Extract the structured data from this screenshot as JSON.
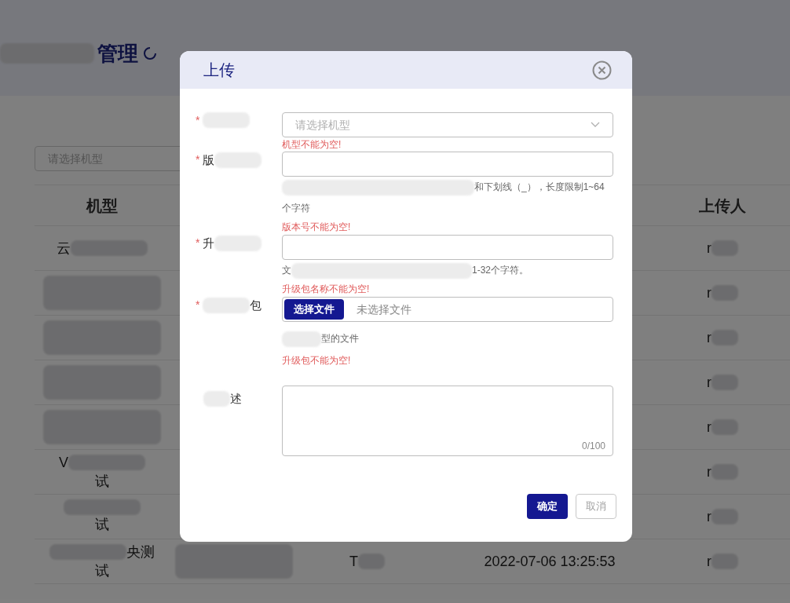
{
  "page": {
    "title_parts": [
      {
        "kind": "blur"
      },
      {
        "kind": "text",
        "text": "管理"
      }
    ],
    "filter": {
      "placeholder": "请选择机型"
    }
  },
  "table": {
    "columns": [
      "机型",
      "",
      "",
      "",
      "上传人"
    ],
    "rows": [
      {
        "cells": [
          {
            "parts": [
              {
                "kind": "text",
                "text": "云"
              },
              {
                "kind": "blur"
              }
            ]
          },
          "",
          "",
          "",
          {
            "parts": [
              {
                "kind": "text",
                "text": "r"
              },
              {
                "kind": "blur"
              }
            ]
          }
        ]
      },
      {
        "cells": [
          {
            "parts": [
              {
                "kind": "blur"
              }
            ]
          },
          "",
          "",
          "",
          {
            "parts": [
              {
                "kind": "text",
                "text": "r"
              },
              {
                "kind": "blur"
              }
            ]
          }
        ]
      },
      {
        "cells": [
          {
            "parts": [
              {
                "kind": "blur"
              }
            ]
          },
          "",
          "",
          "",
          {
            "parts": [
              {
                "kind": "text",
                "text": "r"
              },
              {
                "kind": "blur"
              }
            ]
          }
        ]
      },
      {
        "cells": [
          {
            "parts": [
              {
                "kind": "blur"
              }
            ]
          },
          "",
          "",
          "",
          {
            "parts": [
              {
                "kind": "text",
                "text": "r"
              },
              {
                "kind": "blur"
              }
            ]
          }
        ]
      },
      {
        "cells": [
          {
            "parts": [
              {
                "kind": "blur"
              }
            ]
          },
          "",
          "",
          "",
          {
            "parts": [
              {
                "kind": "text",
                "text": "r"
              },
              {
                "kind": "blur"
              }
            ]
          }
        ]
      },
      {
        "cells": [
          {
            "parts": [
              {
                "kind": "text",
                "text": "V"
              },
              {
                "kind": "blur"
              },
              {
                "kind": "break"
              },
              {
                "kind": "text",
                "text": "试"
              }
            ]
          },
          "",
          "",
          "",
          {
            "parts": [
              {
                "kind": "text",
                "text": "r"
              },
              {
                "kind": "blur"
              }
            ]
          }
        ]
      },
      {
        "cells": [
          {
            "parts": [
              {
                "kind": "blur"
              },
              {
                "kind": "break"
              },
              {
                "kind": "text",
                "text": "试"
              }
            ]
          },
          "",
          "",
          "",
          {
            "parts": [
              {
                "kind": "text",
                "text": "r"
              },
              {
                "kind": "blur"
              }
            ]
          }
        ]
      },
      {
        "cells": [
          {
            "parts": [
              {
                "kind": "blur"
              },
              {
                "kind": "text",
                "text": "央测"
              },
              {
                "kind": "break"
              },
              {
                "kind": "text",
                "text": "试"
              }
            ]
          },
          {
            "parts": [
              {
                "kind": "blur"
              }
            ]
          },
          {
            "parts": [
              {
                "kind": "text",
                "text": "T"
              },
              {
                "kind": "blur"
              }
            ]
          },
          {
            "parts": [
              {
                "kind": "text",
                "text": "2022-07-06 13:25:53"
              }
            ]
          },
          {
            "parts": [
              {
                "kind": "text",
                "text": "r"
              },
              {
                "kind": "blur"
              }
            ]
          }
        ]
      }
    ]
  },
  "dialog": {
    "title": "上传",
    "fields": [
      {
        "kind": "select",
        "required_mark": "*",
        "label_parts": [
          {
            "kind": "blur"
          }
        ],
        "placeholder": "请选择机型",
        "error": "机型不能为空!"
      },
      {
        "kind": "input",
        "required_mark": "*",
        "label_parts": [
          {
            "kind": "text",
            "text": "版"
          },
          {
            "kind": "blur"
          }
        ],
        "hint_parts": [
          {
            "kind": "blur"
          },
          {
            "kind": "text",
            "text": "和下划线（_），长度限制1~64"
          },
          {
            "kind": "break"
          },
          {
            "kind": "text",
            "text": "个字符"
          }
        ],
        "error": "版本号不能为空!"
      },
      {
        "kind": "input",
        "required_mark": "*",
        "label_parts": [
          {
            "kind": "text",
            "text": "升"
          },
          {
            "kind": "blur"
          }
        ],
        "hint_parts": [
          {
            "kind": "text",
            "text": "文"
          },
          {
            "kind": "blur"
          },
          {
            "kind": "text",
            "text": "1-32个字符。"
          }
        ],
        "error": "升级包名称不能为空!"
      },
      {
        "kind": "file",
        "required_mark": "*",
        "label_parts": [
          {
            "kind": "blur"
          },
          {
            "kind": "text",
            "text": "包"
          }
        ],
        "button": "选择文件",
        "file_text": "未选择文件",
        "hint_parts": [
          {
            "kind": "blur"
          },
          {
            "kind": "text",
            "text": "型的文件"
          }
        ],
        "error": "升级包不能为空!"
      },
      {
        "kind": "textarea",
        "label_parts": [
          {
            "kind": "blur"
          },
          {
            "kind": "text",
            "text": "述"
          }
        ],
        "counter": "0/100"
      }
    ],
    "buttons": [
      {
        "kind": "primary",
        "label": "确定"
      },
      {
        "kind": "secondary",
        "label": "取消"
      }
    ]
  }
}
